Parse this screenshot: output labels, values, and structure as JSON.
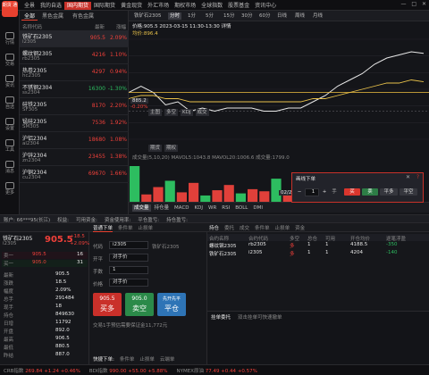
{
  "app": {
    "logo_text": "期货\n通",
    "top_tabs": [
      "全景",
      "我的自选",
      "国内期货",
      "国际期货",
      "黄金现货",
      "外汇市场",
      "期权市场",
      "全球指数",
      "股票基金",
      "资讯中心"
    ],
    "active_top_tab": "国内期货"
  },
  "sidebar": {
    "items": [
      {
        "label": "行情"
      },
      {
        "label": "交易"
      },
      {
        "label": "资讯"
      },
      {
        "label": "自选"
      },
      {
        "label": "设置"
      },
      {
        "label": "工具"
      },
      {
        "label": "消息"
      },
      {
        "label": "更多"
      }
    ]
  },
  "quotes": {
    "tabs": [
      "全部",
      "黑色金属",
      "有色金属"
    ],
    "headers": {
      "name": "名称代码",
      "price": "最新",
      "pct": "涨幅"
    },
    "rows": [
      {
        "name": "铁矿石2305",
        "code": "i2305",
        "price": "905.5",
        "pct": "2.09%",
        "dir": "up"
      },
      {
        "name": "螺纹钢2305",
        "code": "rb2305",
        "price": "4216",
        "pct": "1.10%",
        "dir": "up"
      },
      {
        "name": "热卷2305",
        "code": "hc2305",
        "price": "4297",
        "pct": "0.94%",
        "dir": "up"
      },
      {
        "name": "不锈钢2304",
        "code": "ss2304",
        "price": "16300",
        "pct": "-1.30%",
        "dir": "down"
      },
      {
        "name": "硅铁2305",
        "code": "SF305",
        "price": "8170",
        "pct": "2.20%",
        "dir": "up"
      },
      {
        "name": "锰硅2305",
        "code": "SM305",
        "price": "7536",
        "pct": "1.92%",
        "dir": "up"
      },
      {
        "name": "沪铝2304",
        "code": "al2304",
        "price": "18680",
        "pct": "1.08%",
        "dir": "up"
      },
      {
        "name": "沪锌2304",
        "code": "zn2304",
        "price": "23455",
        "pct": "1.38%",
        "dir": "up"
      },
      {
        "name": "沪铜2304",
        "code": "cu2304",
        "price": "69670",
        "pct": "1.66%",
        "dir": "up"
      }
    ]
  },
  "chart": {
    "toolbar": [
      "铁矿石2305",
      "分时",
      "1分",
      "5分",
      "15分",
      "30分",
      "60分",
      "日线",
      "周线",
      "月线"
    ],
    "active_tool": "分时",
    "title_line": "铁矿石2305 今开:892.0 昨结:887.0 最高:906.5 最低:880.5 成交量:29.1万",
    "info_line": "价格:905.5   2023-03-15 11:30-13:30 详情",
    "sub_info": "均价:896.4",
    "left_value": "885.2",
    "left_pct": "-0.20%",
    "indicator_tabs": [
      "主图",
      "多空",
      "KDJ",
      "成交"
    ],
    "sub_tabs": [
      "期货",
      "期权"
    ],
    "ma_line": "成交量(5,10,20)  MAVOL5:1043.8  MAVOL20:1006.6  成交量:1799.0",
    "bottom_tabs": [
      "成交量",
      "持仓量",
      "MACD",
      "KDJ",
      "WR",
      "RSI",
      "BOLL",
      "DMI"
    ],
    "date_label": "02/28",
    "chart_data": {
      "type": "line",
      "title": "",
      "xlabel": "",
      "ylabel": "",
      "series": [
        {
          "values": [
            893,
            895,
            893,
            889,
            890,
            887,
            888,
            887,
            888,
            888,
            888,
            887,
            887,
            888,
            888,
            890,
            892,
            895,
            897,
            899,
            902,
            904,
            905,
            906,
            905.5
          ]
        },
        {
          "values": [
            891,
            892,
            892,
            891,
            891,
            890,
            890,
            890,
            890,
            890,
            890,
            890,
            890,
            890,
            890,
            891,
            891,
            892,
            893,
            894,
            895,
            896,
            896,
            897,
            896.4
          ]
        }
      ],
      "ylim": [
        878,
        910
      ],
      "volume": [
        34,
        7,
        14,
        20,
        9,
        18,
        6,
        11,
        16,
        8,
        12,
        10,
        22,
        9,
        13,
        7,
        15,
        11,
        9,
        18,
        20,
        10,
        8,
        12,
        9
      ]
    },
    "order_dialog": {
      "title": "画线下单",
      "qty": "1",
      "qty_unit": "手",
      "buy": "买",
      "sell": "卖",
      "flat": "平多",
      "flat2": "平空"
    }
  },
  "trade": {
    "bar_items": [
      "账户: 66***95(长江)",
      "权益: ",
      "可用资金: ",
      "资金使用率: ",
      "平仓盈亏: ",
      "持仓盈亏: "
    ],
    "sub_tabs": [
      "普通下单",
      "条件单",
      "止损单"
    ],
    "book": {
      "name": "铁矿石2305",
      "code": "i2305",
      "price": "905.5",
      "change": "+18.5",
      "pct": "+2.09%",
      "sell_label": "卖一",
      "sell_price": "905.5",
      "sell_vol": "16",
      "buy_label": "买一",
      "buy_price": "905.0",
      "buy_vol": "31",
      "stats": [
        {
          "k": "最新",
          "v": "905.5"
        },
        {
          "k": "涨跌",
          "v": "18.5"
        },
        {
          "k": "幅度",
          "v": "2.09%"
        },
        {
          "k": "总手",
          "v": "291484"
        },
        {
          "k": "现手",
          "v": "18"
        },
        {
          "k": "持仓",
          "v": "849630"
        },
        {
          "k": "日增",
          "v": "11792"
        },
        {
          "k": "开盘",
          "v": "892.0"
        },
        {
          "k": "最高",
          "v": "906.5"
        },
        {
          "k": "最低",
          "v": "880.5"
        },
        {
          "k": "昨结",
          "v": "887.0"
        }
      ]
    },
    "form": {
      "code_label": "代码",
      "code_value": "i2305",
      "name_value": "铁矿石2305",
      "open_label": "开平",
      "open_value": "对手价",
      "qty_label": "手数",
      "qty_value": "1",
      "price_label": "价格",
      "price_value": "对手价",
      "buy_price": "905.5",
      "buy_label": "买多",
      "sell_price": "905.0",
      "sell_label": "卖空",
      "flat_label": "平仓",
      "flat_sub": "先开先平",
      "margin_note": "交易1手预估需要保证金11,772元"
    },
    "positions": {
      "tabs": [
        "持仓",
        "委托",
        "成交",
        "条件单",
        "止损单",
        "资金"
      ],
      "headers": [
        "合约名称",
        "合约代码",
        "多空",
        "总仓",
        "可用",
        "开仓均价",
        "逐笔浮盈"
      ],
      "rows": [
        {
          "name": "螺纹钢2305",
          "code": "rb2305",
          "dir": "多",
          "total": "1",
          "avail": "1",
          "avg": "4188.5",
          "pnl": "-350"
        },
        {
          "name": "铁矿石2305",
          "code": "i2305",
          "dir": "多",
          "total": "1",
          "avail": "1",
          "avg": "4204",
          "pnl": "-140"
        }
      ]
    },
    "log": {
      "title": "挂单委托",
      "sub": "双击挂单可快速撤单",
      "quick_label": "快捷下单:",
      "quick_items": [
        "条件单",
        "止损单",
        "云端单"
      ]
    }
  },
  "status": {
    "items": [
      {
        "label": "CRB指数",
        "value": "269.84",
        "chg": "+1.24",
        "pct": "+0.46%"
      },
      {
        "label": "BDI指数",
        "value": "990.00",
        "chg": "+55.00",
        "pct": "+5.88%"
      },
      {
        "label": "NYMEX原油",
        "value": "77.49",
        "chg": "+0.44",
        "pct": "+0.57%"
      }
    ]
  }
}
